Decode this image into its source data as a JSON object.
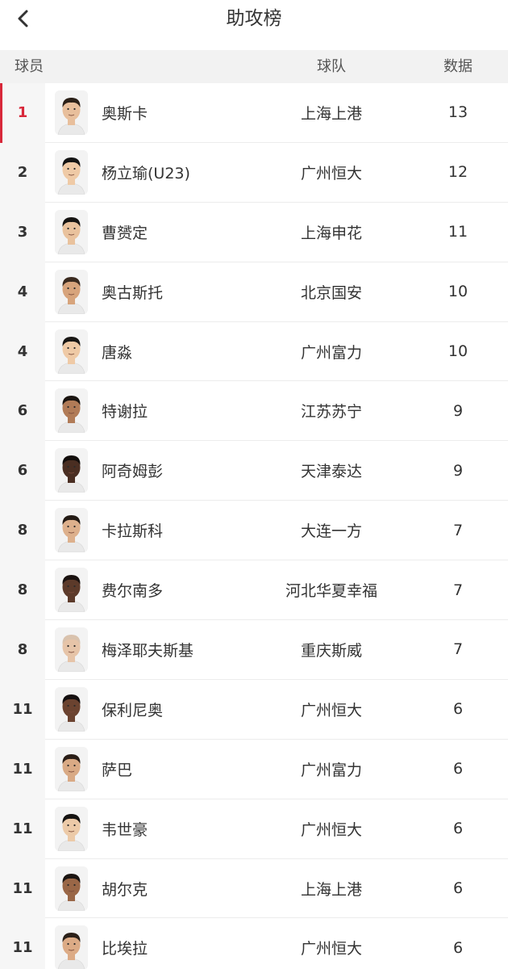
{
  "header": {
    "title": "助攻榜",
    "back_icon": "chevron-left-icon"
  },
  "columns": {
    "player": "球员",
    "team": "球队",
    "stat": "数据"
  },
  "colors": {
    "accent": "#d8283a",
    "rank_column_bg": "#f6f6f6",
    "column_header_bg": "#f2f2f2"
  },
  "players": [
    {
      "rank": "1",
      "name": "奥斯卡",
      "team": "上海上港",
      "stat": "13",
      "skin": "#e8bf9c",
      "hair": "#2b2018"
    },
    {
      "rank": "2",
      "name": "杨立瑜(U23)",
      "team": "广州恒大",
      "stat": "12",
      "skin": "#efcaa6",
      "hair": "#141414"
    },
    {
      "rank": "3",
      "name": "曹赟定",
      "team": "上海申花",
      "stat": "11",
      "skin": "#e9c29d",
      "hair": "#161412"
    },
    {
      "rank": "4",
      "name": "奥古斯托",
      "team": "北京国安",
      "stat": "10",
      "skin": "#d7a47c",
      "hair": "#3a2a1f"
    },
    {
      "rank": "4",
      "name": "唐淼",
      "team": "广州富力",
      "stat": "10",
      "skin": "#efcaa6",
      "hair": "#181614"
    },
    {
      "rank": "6",
      "name": "特谢拉",
      "team": "江苏苏宁",
      "stat": "9",
      "skin": "#b17b57",
      "hair": "#1a1410"
    },
    {
      "rank": "6",
      "name": "阿奇姆彭",
      "team": "天津泰达",
      "stat": "9",
      "skin": "#4a2e22",
      "hair": "#120d0b"
    },
    {
      "rank": "8",
      "name": "卡拉斯科",
      "team": "大连一方",
      "stat": "7",
      "skin": "#ddb08c",
      "hair": "#231a14"
    },
    {
      "rank": "8",
      "name": "费尔南多",
      "team": "河北华夏幸福",
      "stat": "7",
      "skin": "#5c3a2a",
      "hair": "#1a1210"
    },
    {
      "rank": "8",
      "name": "梅泽耶夫斯基",
      "team": "重庆斯威",
      "stat": "7",
      "skin": "#e6c4a8",
      "hair": "#d9c2ad"
    },
    {
      "rank": "11",
      "name": "保利尼奥",
      "team": "广州恒大",
      "stat": "6",
      "skin": "#6b4330",
      "hair": "#151010"
    },
    {
      "rank": "11",
      "name": "萨巴",
      "team": "广州富力",
      "stat": "6",
      "skin": "#d9aa85",
      "hair": "#2a1e17"
    },
    {
      "rank": "11",
      "name": "韦世豪",
      "team": "广州恒大",
      "stat": "6",
      "skin": "#eccaa8",
      "hair": "#161412"
    },
    {
      "rank": "11",
      "name": "胡尔克",
      "team": "上海上港",
      "stat": "6",
      "skin": "#9a6747",
      "hair": "#1c1512"
    },
    {
      "rank": "11",
      "name": "比埃拉",
      "team": "广州恒大",
      "stat": "6",
      "skin": "#dcab86",
      "hair": "#2b2019"
    }
  ]
}
